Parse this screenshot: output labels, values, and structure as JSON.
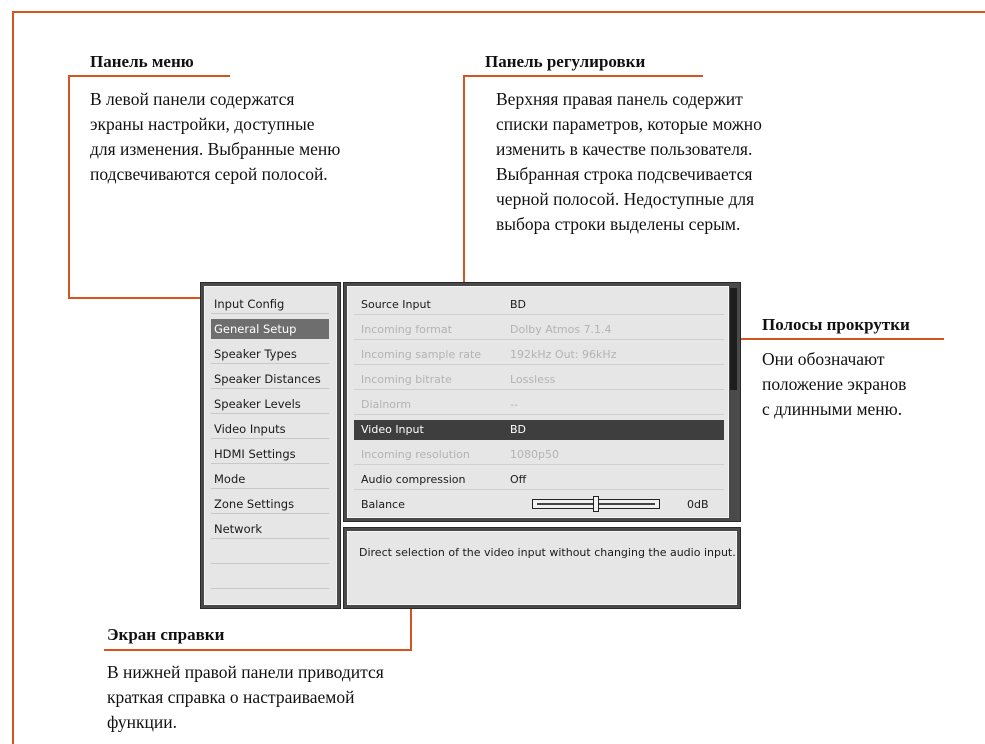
{
  "annotations": {
    "menu_panel": {
      "title": "Панель меню",
      "lines": [
        "В левой панели содержатся",
        "экраны настройки, доступные",
        "для изменения. Выбранные меню",
        "подсвечиваются серой полосой."
      ]
    },
    "adjust_panel": {
      "title": "Панель регулировки",
      "lines": [
        "Верхняя правая панель содержит",
        "списки параметров, которые можно",
        "изменить в качестве пользователя.",
        "Выбранная строка подсвечивается",
        "черной полосой. Недоступные для",
        "выбора строки выделены серым."
      ]
    },
    "scrollbars": {
      "title": "Полосы прокрутки",
      "lines": [
        "Они обозначают",
        "положение экранов",
        "с длинными меню."
      ]
    },
    "help_screen": {
      "title": "Экран справки",
      "lines": [
        "В нижней правой панели приводится",
        "краткая справка о настраиваемой",
        "функции."
      ]
    }
  },
  "menu": {
    "items": [
      "Input Config",
      "General Setup",
      "Speaker Types",
      "Speaker Distances",
      "Speaker Levels",
      "Video Inputs",
      "HDMI Settings",
      "Mode",
      "Zone Settings",
      "Network"
    ],
    "selected_index": 1
  },
  "settings": {
    "rows": [
      {
        "label": "Source Input",
        "value": "BD",
        "state": "normal"
      },
      {
        "label": "Incoming format",
        "value": "Dolby Atmos 7.1.4",
        "state": "dim"
      },
      {
        "label": "Incoming sample rate",
        "value": "192kHz Out: 96kHz",
        "state": "dim"
      },
      {
        "label": "Incoming bitrate",
        "value": "Lossless",
        "state": "dim"
      },
      {
        "label": "Dialnorm",
        "value": "--",
        "state": "dim"
      },
      {
        "label": "Video Input",
        "value": "BD",
        "state": "selected"
      },
      {
        "label": "Incoming resolution",
        "value": "1080p50",
        "state": "dim"
      },
      {
        "label": "Audio compression",
        "value": "Off",
        "state": "normal"
      }
    ],
    "balance": {
      "label": "Balance",
      "value": "0dB",
      "position_fraction": 0.5
    }
  },
  "help": {
    "text": "Direct selection of the video input without changing the audio input."
  },
  "colors": {
    "accent_line": "#d4541f",
    "panel_frame": "#4a4a4a",
    "menu_highlight": "#6e6e6e",
    "row_highlight": "#3e3e3e"
  }
}
